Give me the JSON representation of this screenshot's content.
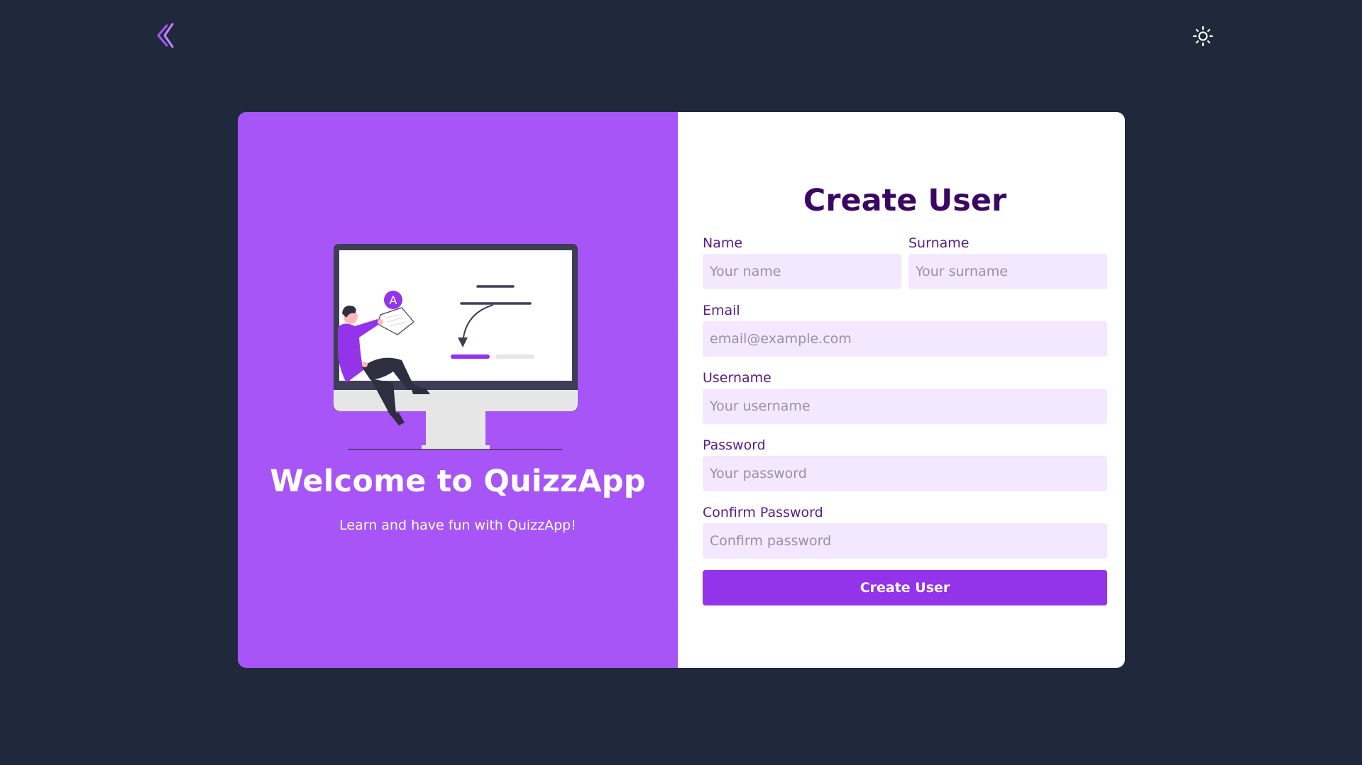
{
  "header": {
    "logo_icon": "double-chevron-left-logo-icon",
    "theme_icon": "sun-icon"
  },
  "welcome": {
    "title": "Welcome to QuizzApp",
    "subtitle": "Learn and have fun with QuizzApp!",
    "illustration_badge": "A"
  },
  "form": {
    "title": "Create User",
    "fields": {
      "name": {
        "label": "Name",
        "placeholder": "Your name"
      },
      "surname": {
        "label": "Surname",
        "placeholder": "Your surname"
      },
      "email": {
        "label": "Email",
        "placeholder": "email@example.com"
      },
      "username": {
        "label": "Username",
        "placeholder": "Your username"
      },
      "password": {
        "label": "Password",
        "placeholder": "Your password"
      },
      "confirm_password": {
        "label": "Confirm Password",
        "placeholder": "Confirm password"
      }
    },
    "submit_label": "Create User"
  },
  "colors": {
    "background": "#1f293b",
    "accent": "#a855f7",
    "button": "#9333ea",
    "title": "#3b0764",
    "label": "#581c87",
    "input_bg": "#f3e8ff"
  }
}
